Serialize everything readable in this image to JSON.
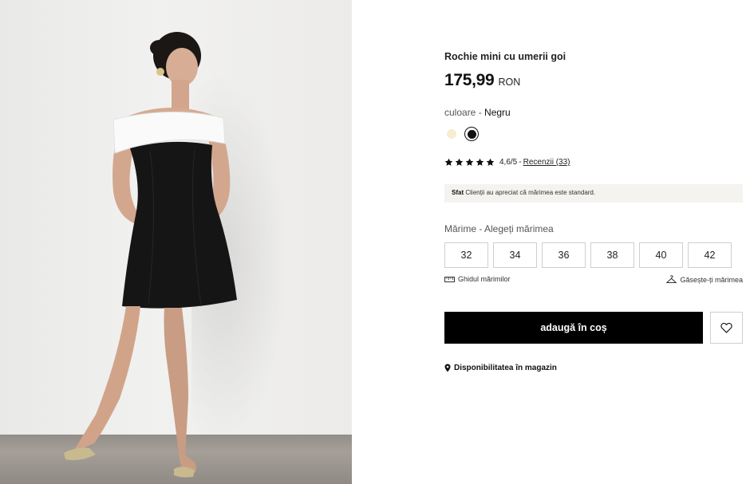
{
  "product": {
    "title": "Rochie mini cu umerii goi",
    "price": "175,99",
    "currency": "RON"
  },
  "color": {
    "label": "culoare - ",
    "selected": "Negru",
    "swatches": [
      {
        "name": "cream",
        "hex": "#f6edd2"
      },
      {
        "name": "black",
        "hex": "#111111",
        "selected": true
      }
    ]
  },
  "rating": {
    "stars": 5,
    "score": "4,6/5",
    "separator": "-",
    "reviews": "Recenzii (33)"
  },
  "tip": {
    "label": "Sfat",
    "text": "Clienții au apreciat că mărimea este standard."
  },
  "size": {
    "label": "Mărime - Alegeți mărimea",
    "options": [
      "32",
      "34",
      "36",
      "38",
      "40",
      "42"
    ],
    "guide": "Ghidul mărimilor",
    "find": "Găsește-ți mărimea"
  },
  "actions": {
    "add_to_cart": "adaugă în coș",
    "store_availability": "Disponibilitatea în magazin"
  },
  "icons": {
    "star": "star-icon",
    "ruler": "ruler-icon",
    "hanger": "hanger-icon",
    "heart": "heart-icon",
    "pin": "location-pin-icon"
  }
}
